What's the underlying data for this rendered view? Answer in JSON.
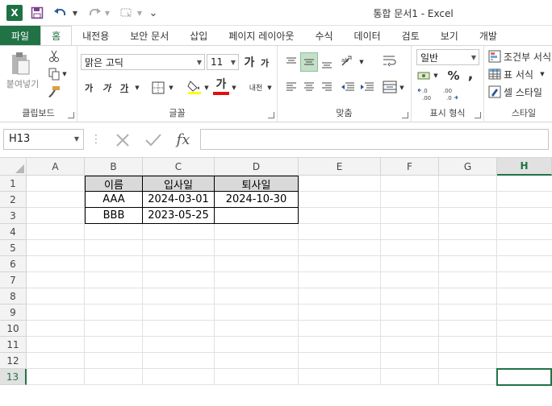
{
  "window": {
    "title": "통합 문서1 - Excel"
  },
  "quick_access": {
    "more": "⌄"
  },
  "tabs": [
    "파일",
    "홈",
    "내전용",
    "보안 문서",
    "삽입",
    "페이지 레이아웃",
    "수식",
    "데이터",
    "검토",
    "보기",
    "개발"
  ],
  "ribbon": {
    "clipboard": {
      "paste": "붙여넣기",
      "label": "클립보드"
    },
    "font": {
      "name": "맑은 고딕",
      "size": "11",
      "grow": "가",
      "shrink": "가",
      "bold": "가",
      "italic": "가",
      "underline": "가",
      "fontcolor": "가",
      "label": "글꼴",
      "phonetic": "내천"
    },
    "align": {
      "label": "맞춤"
    },
    "number": {
      "format": "일반",
      "percent": "%",
      "comma": ",",
      "label": "표시 형식",
      "inc": "←.0\n.00",
      "dec": ".00\n→.0"
    },
    "styles": {
      "cond": "조건부 서식",
      "table": "표 서식",
      "cell": "셀 스타일",
      "label": "스타일"
    }
  },
  "formula_bar": {
    "name_box": "H13",
    "fx": "fx",
    "value": ""
  },
  "sheet": {
    "columns": [
      "A",
      "B",
      "C",
      "D",
      "E",
      "F",
      "G",
      "H"
    ],
    "rows": [
      "1",
      "2",
      "3",
      "4",
      "5",
      "6",
      "7",
      "8",
      "9",
      "10",
      "11",
      "12",
      "13"
    ],
    "selected_cell": "H13",
    "table": {
      "headers": [
        "이름",
        "입사일",
        "퇴사일"
      ],
      "rows": [
        [
          "AAA",
          "2024-03-01",
          "2024-10-30"
        ],
        [
          "BBB",
          "2023-05-25",
          ""
        ]
      ]
    }
  },
  "colors": {
    "accent": "#217346",
    "header_fill": "#d9d9d9",
    "font_red": "#e01010"
  }
}
